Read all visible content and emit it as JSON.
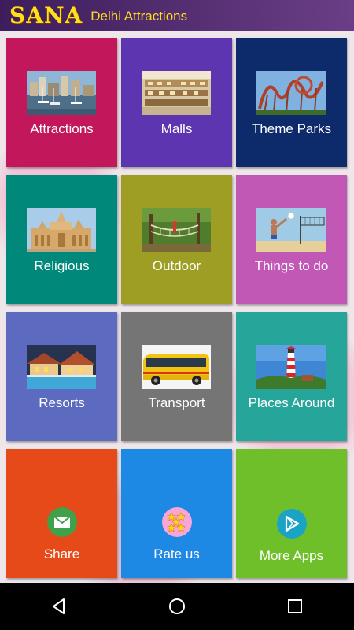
{
  "header": {
    "brand": "SANA",
    "title": "Delhi Attractions"
  },
  "tiles": [
    {
      "label": "Attractions",
      "color": "#c2185b",
      "image": "harbor-city-photo"
    },
    {
      "label": "Malls",
      "color": "#5e35b1",
      "image": "mall-interior-photo"
    },
    {
      "label": "Theme Parks",
      "color": "#0d2a6b",
      "image": "roller-coaster-photo"
    },
    {
      "label": "Religious",
      "color": "#00897b",
      "image": "temple-photo"
    },
    {
      "label": "Outdoor",
      "color": "#9e9d24",
      "image": "rope-course-photo"
    },
    {
      "label": "Things to do",
      "color": "#c158b6",
      "image": "beach-volleyball-photo"
    },
    {
      "label": "Resorts",
      "color": "#5c6bc0",
      "image": "resort-pool-photo"
    },
    {
      "label": "Transport",
      "color": "#757575",
      "image": "yellow-bus-photo"
    },
    {
      "label": "Places Around",
      "color": "#26a69a",
      "image": "lighthouse-photo"
    },
    {
      "label": "Share",
      "color": "#e64a19",
      "icon": "share-mail-icon"
    },
    {
      "label": "Rate us",
      "color": "#1e88e5",
      "icon": "rate-stars-icon"
    },
    {
      "label": "More Apps",
      "color": "#6fbf2a",
      "icon": "play-store-icon"
    }
  ],
  "navbar": {
    "back": "back-icon",
    "home": "home-icon",
    "recents": "recents-icon"
  }
}
